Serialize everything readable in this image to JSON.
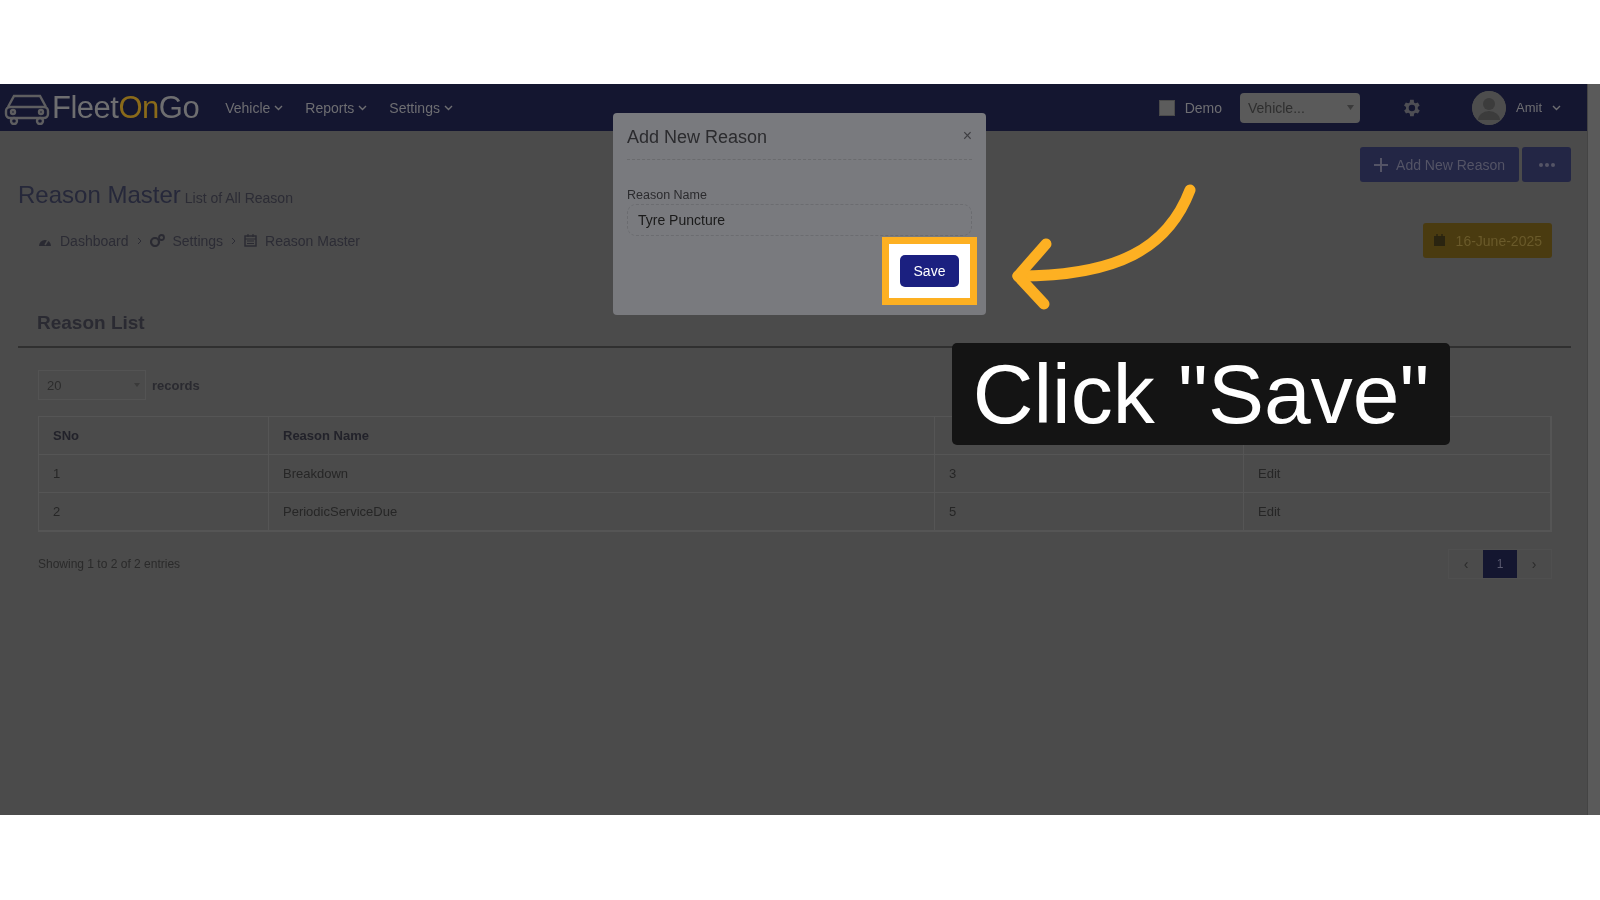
{
  "navbar": {
    "logo": [
      {
        "text": "Fleet",
        "accent": false
      },
      {
        "text": "On",
        "accent": true
      },
      {
        "text": "Go",
        "accent": false
      }
    ],
    "menu": [
      {
        "label": "Vehicle"
      },
      {
        "label": "Reports"
      },
      {
        "label": "Settings"
      }
    ],
    "demo": {
      "label": "Demo",
      "checked": false
    },
    "vehicle_select": {
      "placeholder": "Vehicle..."
    },
    "user": {
      "name": "Amit"
    }
  },
  "page_header": {
    "title": "Reason Master",
    "subtitle": "List of All Reason",
    "add_button": "Add New Reason",
    "date": "16-June-2025",
    "breadcrumb": [
      {
        "kind": "dashboard",
        "label": "Dashboard"
      },
      {
        "kind": "settings",
        "label": "Settings"
      },
      {
        "kind": "calendar",
        "label": "Reason Master"
      }
    ]
  },
  "card": {
    "title": "Reason List",
    "page_length": "20",
    "records_label": "records",
    "table": {
      "columns": [
        "SNo",
        "Reason Name"
      ],
      "rows": [
        [
          "1",
          "Breakdown",
          "3",
          "Edit"
        ],
        [
          "2",
          "PeriodicServiceDue",
          "5",
          "Edit"
        ]
      ]
    },
    "info": "Showing 1 to 2 of 2 entries",
    "pagination": {
      "prev": "‹",
      "pages": [
        {
          "label": "1",
          "selected": true
        }
      ],
      "next": "›"
    }
  },
  "modal": {
    "title": "Add New Reason",
    "close": "×",
    "field_label": "Reason Name",
    "field_value": "Tyre Puncture",
    "save": "Save"
  },
  "callout": {
    "text": "Click \"Save\""
  }
}
